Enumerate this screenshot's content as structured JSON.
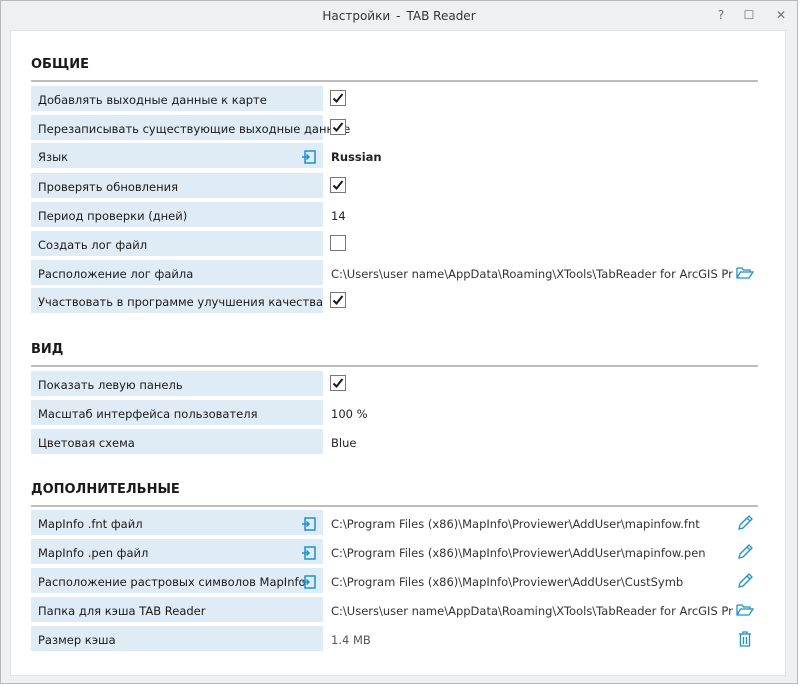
{
  "window": {
    "title_app": "Настройки",
    "title_sep": "-",
    "title_name": "TAB Reader",
    "help_label": "?",
    "maximize_label": "☐",
    "close_label": "✕"
  },
  "general": {
    "title": "ОБЩИЕ",
    "add_output": {
      "label": "Добавлять выходные данные к карте",
      "checked": true
    },
    "overwrite": {
      "label": "Перезаписывать существующие выходные данные",
      "checked": true
    },
    "language": {
      "label": "Язык",
      "value": "Russian"
    },
    "check_updates": {
      "label": "Проверять обновления",
      "checked": true
    },
    "check_period": {
      "label": "Период проверки (дней)",
      "value": "14"
    },
    "create_log": {
      "label": "Создать лог файл",
      "checked": false
    },
    "log_location": {
      "label": "Расположение лог файла",
      "value": "C:\\Users\\user name\\AppData\\Roaming\\XTools\\TabReader for ArcGIS Pro\\Logs"
    },
    "quality_program": {
      "label": "Участвовать в программе улучшения качества",
      "checked": true
    }
  },
  "view": {
    "title": "ВИД",
    "show_left_panel": {
      "label": "Показать левую панель",
      "checked": true
    },
    "ui_scale": {
      "label": "Масштаб интерфейса пользователя",
      "value": "100 %"
    },
    "color_scheme": {
      "label": "Цветовая схема",
      "value": "Blue"
    }
  },
  "additional": {
    "title": "ДОПОЛНИТЕЛЬНЫЕ",
    "fnt_file": {
      "label": "MapInfo .fnt файл",
      "value": "C:\\Program Files (x86)\\MapInfo\\Proviewer\\AddUser\\mapinfow.fnt"
    },
    "pen_file": {
      "label": "MapInfo .pen файл",
      "value": "C:\\Program Files (x86)\\MapInfo\\Proviewer\\AddUser\\mapinfow.pen"
    },
    "raster_symbols": {
      "label": "Расположение растровых символов MapInfo",
      "value": "C:\\Program Files (x86)\\MapInfo\\Proviewer\\AddUser\\CustSymb"
    },
    "cache_folder": {
      "label": "Папка для кэша TAB Reader",
      "value": "C:\\Users\\user name\\AppData\\Roaming\\XTools\\TabReader for ArcGIS Pro\\Cache"
    },
    "cache_size": {
      "label": "Размер кэша",
      "value": "1.4 MB"
    }
  },
  "colors": {
    "label_bg": "#dfecf6",
    "accent": "#1e90c8",
    "section_line": "#bdbdbd"
  },
  "icons": {
    "reset": "reset-to-default-icon",
    "folder": "folder-open-icon",
    "edit": "pencil-icon",
    "clear": "trash-icon"
  }
}
